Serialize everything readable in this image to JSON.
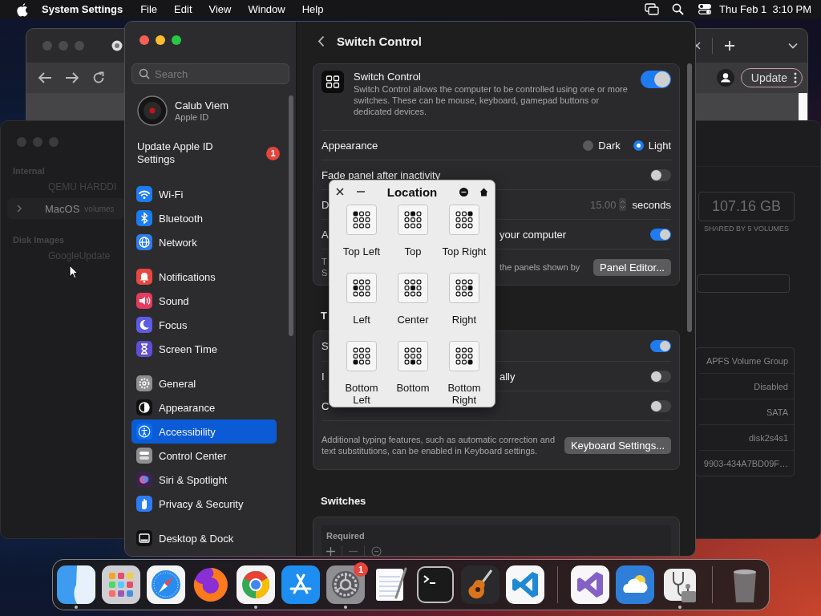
{
  "menu_bar": {
    "app_name": "System Settings",
    "menus": [
      "File",
      "Edit",
      "View",
      "Window",
      "Help"
    ],
    "clock": "Thu Feb 1  3:10 PM"
  },
  "browser_window": {
    "update_button": "Update"
  },
  "disk_utility": {
    "sidebar": [
      {
        "kind": "header",
        "label": "Internal"
      },
      {
        "kind": "disk",
        "label": "QEMU HARDDI"
      },
      {
        "kind": "volume",
        "label": "MacOS",
        "detail": "volumes"
      },
      {
        "kind": "header",
        "label": "Disk Images"
      },
      {
        "kind": "disk",
        "label": "GoogleUpdate"
      }
    ],
    "capacity": "107.16 GB",
    "capacity_caption": "SHARED BY 5 VOLUMES",
    "info_values": [
      "APFS Volume Group",
      "Disabled",
      "SATA",
      "disk2s4s1",
      "9903-434A7BD09F…"
    ]
  },
  "settings": {
    "search_placeholder": "Search",
    "account": {
      "name": "Calub Viem",
      "subtitle": "Apple ID"
    },
    "account_notice": {
      "label": "Update Apple ID Settings",
      "badge": "1"
    },
    "sidebar_groups": [
      [
        {
          "label": "Wi-Fi",
          "color": "#1d7cf2",
          "selected": false
        },
        {
          "label": "Bluetooth",
          "color": "#1d7cf2",
          "selected": false
        },
        {
          "label": "Network",
          "color": "#2f7cf0",
          "selected": false
        }
      ],
      [
        {
          "label": "Notifications",
          "color": "#e8463f",
          "selected": false
        },
        {
          "label": "Sound",
          "color": "#e83a5e",
          "selected": false
        },
        {
          "label": "Focus",
          "color": "#5e5ce6",
          "selected": false
        },
        {
          "label": "Screen Time",
          "color": "#5e4fd6",
          "selected": false
        }
      ],
      [
        {
          "label": "General",
          "color": "#8e8e93",
          "selected": false
        },
        {
          "label": "Appearance",
          "color": "#111111",
          "selected": false
        },
        {
          "label": "Accessibility",
          "color": "#0a6cf0",
          "selected": true
        },
        {
          "label": "Control Center",
          "color": "#8e8e93",
          "selected": false
        },
        {
          "label": "Siri & Spotlight",
          "color": "#3a2350",
          "selected": false
        },
        {
          "label": "Privacy & Security",
          "color": "#2d7cf6",
          "selected": false
        }
      ],
      [
        {
          "label": "Desktop & Dock",
          "color": "#111111",
          "selected": false
        }
      ]
    ],
    "page_title": "Switch Control",
    "feature": {
      "title": "Switch Control",
      "description": "Switch Control allows the computer to be controlled using one or more switches. These can be mouse, keyboard, gamepad buttons or dedicated devices.",
      "on": true
    },
    "panel_rows": [
      {
        "kind": "radio",
        "label": "Appearance",
        "options": [
          {
            "label": "Dark",
            "selected": false
          },
          {
            "label": "Light",
            "selected": true
          }
        ]
      },
      {
        "kind": "toggle",
        "label": "Fade panel after inactivity",
        "on": false
      },
      {
        "kind": "stepper",
        "label": "D",
        "value": "15.00",
        "unit": "seconds"
      },
      {
        "kind": "toggle",
        "label": "A",
        "tail": "your computer",
        "on": true
      },
      {
        "kind": "note",
        "lines": [
          "T",
          "S"
        ],
        "tail": "the panels shown by",
        "button": "Panel Editor..."
      }
    ],
    "section_title": "T",
    "typing_rows": [
      {
        "kind": "toggle",
        "label": "S",
        "on": true
      },
      {
        "kind": "toggle",
        "label": "I",
        "tail": "ally",
        "on": false
      },
      {
        "kind": "toggle",
        "label": "C",
        "on": false
      },
      {
        "kind": "note",
        "text": "Additional typing features, such as automatic correction and text substitutions, can be enabled in Keyboard settings.",
        "button": "Keyboard Settings..."
      }
    ],
    "switches": {
      "title": "Switches",
      "table_header": "Required"
    }
  },
  "location_panel": {
    "title": "Location",
    "cells": [
      {
        "label": "Top Left"
      },
      {
        "label": "Top"
      },
      {
        "label": "Top Right"
      },
      {
        "label": "Left"
      },
      {
        "label": "Center"
      },
      {
        "label": "Right"
      },
      {
        "label": "Bottom Left"
      },
      {
        "label": "Bottom"
      },
      {
        "label": "Bottom Right"
      }
    ]
  },
  "dock": {
    "items": [
      {
        "kind": "finder",
        "running": true
      },
      {
        "kind": "launchpad",
        "running": false
      },
      {
        "kind": "safari",
        "running": false
      },
      {
        "kind": "firefox",
        "running": false
      },
      {
        "kind": "chrome",
        "running": true
      },
      {
        "kind": "appstore",
        "running": false
      },
      {
        "kind": "settings",
        "running": true,
        "badge": "1"
      },
      {
        "kind": "textedit",
        "running": false
      },
      {
        "kind": "terminal",
        "running": false
      },
      {
        "kind": "garageband",
        "running": false
      },
      {
        "kind": "vscode",
        "running": false
      },
      {
        "kind": "separator"
      },
      {
        "kind": "vstudio",
        "running": false
      },
      {
        "kind": "weather",
        "running": false
      },
      {
        "kind": "diskutil",
        "running": true
      },
      {
        "kind": "separator"
      },
      {
        "kind": "trash",
        "running": false
      }
    ]
  }
}
